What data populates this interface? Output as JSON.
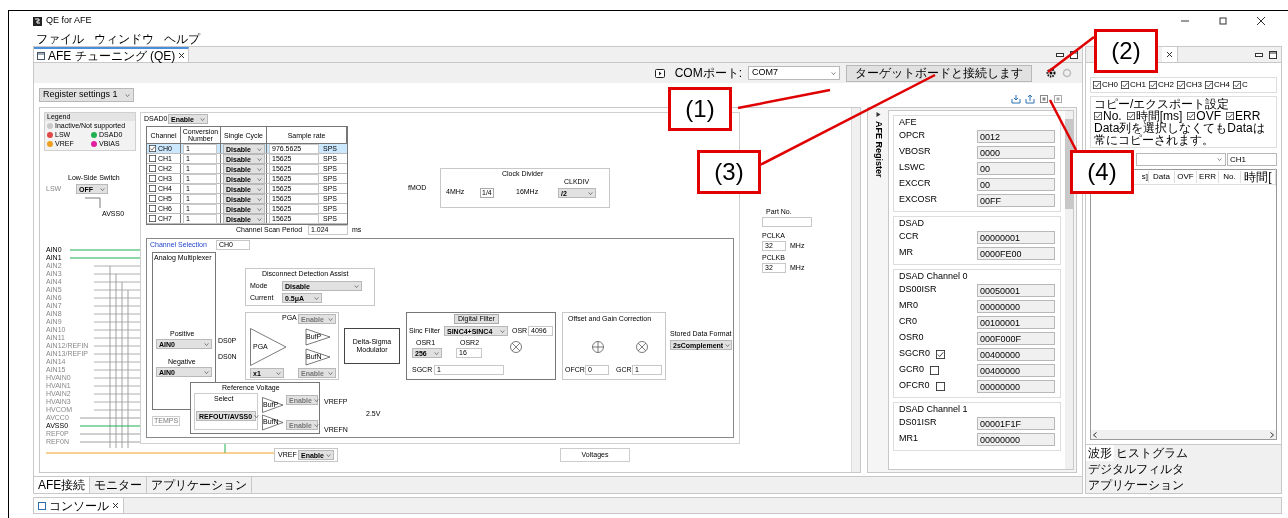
{
  "window": {
    "title": "QE for AFE"
  },
  "menu": [
    "ファイル",
    "ウィンドウ",
    "ヘルプ"
  ],
  "editor_tab": {
    "label": "AFE チューニング (QE)"
  },
  "toolbar": {
    "com_label": "COMポート:",
    "com_value": "COM7",
    "connect_button": "ターゲットボードと接続します"
  },
  "register_select": "Register settings 1",
  "legend": {
    "title": "Legend",
    "items": [
      {
        "label": "Inactive/Not supported",
        "color": "#c8c8c8"
      },
      {
        "label": "LSW",
        "color": "#e04848"
      },
      {
        "label": "DSAD0",
        "color": "#20b050"
      },
      {
        "label": "VREF",
        "color": "#f0a020"
      },
      {
        "label": "VBIAS",
        "color": "#e020a0"
      }
    ]
  },
  "dsad0": {
    "label": "DSAD0",
    "value": "Enable"
  },
  "channel_table": {
    "columns": [
      "Channel",
      "Conversion Number",
      "Single Cycle",
      "Sample rate"
    ],
    "rows": [
      {
        "channel": "CH0",
        "checked": true,
        "selected": true,
        "number": "1",
        "cycle": "Disable",
        "rate": "976.5625",
        "unit": "SPS"
      },
      {
        "channel": "CH1",
        "checked": false,
        "selected": false,
        "number": "1",
        "cycle": "Disable",
        "rate": "15625",
        "unit": "SPS"
      },
      {
        "channel": "CH2",
        "checked": false,
        "selected": false,
        "number": "1",
        "cycle": "Disable",
        "rate": "15625",
        "unit": "SPS"
      },
      {
        "channel": "CH3",
        "checked": false,
        "selected": false,
        "number": "1",
        "cycle": "Disable",
        "rate": "15625",
        "unit": "SPS"
      },
      {
        "channel": "CH4",
        "checked": false,
        "selected": false,
        "number": "1",
        "cycle": "Disable",
        "rate": "15625",
        "unit": "SPS"
      },
      {
        "channel": "CH5",
        "checked": false,
        "selected": false,
        "number": "1",
        "cycle": "Disable",
        "rate": "15625",
        "unit": "SPS"
      },
      {
        "channel": "CH6",
        "checked": false,
        "selected": false,
        "number": "1",
        "cycle": "Disable",
        "rate": "15625",
        "unit": "SPS"
      },
      {
        "channel": "CH7",
        "checked": false,
        "selected": false,
        "number": "1",
        "cycle": "Disable",
        "rate": "15625",
        "unit": "SPS"
      }
    ],
    "scan_label": "Channel Scan Period",
    "scan_value": "1.024",
    "scan_unit": "ms"
  },
  "low_side_switch": {
    "title": "Low-Side Switch",
    "value": "OFF",
    "pin": "LSW",
    "ground": "AVSS0"
  },
  "clock_divider": {
    "title": "Clock Divider",
    "fmod": "fMOD",
    "out": "4MHz",
    "ratio": "1/4",
    "in": "16MHz",
    "clkdiv_label": "CLKDIV",
    "clkdiv_value": "/2"
  },
  "part": {
    "label": "Part No.",
    "clocks": [
      {
        "label": "PCLKA",
        "value": "32",
        "unit": "MHz"
      },
      {
        "label": "PCLKB",
        "value": "32",
        "unit": "MHz"
      }
    ]
  },
  "channel_selection": {
    "label": "Channel Selection",
    "value": "CH0"
  },
  "pins": [
    "AIN0",
    "AIN1",
    "AIN2",
    "AIN3",
    "AIN4",
    "AIN5",
    "AIN6",
    "AIN7",
    "AIN8",
    "AIN9",
    "AIN10",
    "AIN11",
    "AIN12/REFIN",
    "AIN13/REFIP",
    "AIN14",
    "AIN15",
    "HVAIN0",
    "HVAIN1",
    "HVAIN2",
    "HVAIN3",
    "HVCOM"
  ],
  "power_pins": [
    "AVCC0",
    "AVSS0",
    "REF0P",
    "REF0N"
  ],
  "mux": {
    "title": "Analog Multiplexer",
    "positive_label": "Positive",
    "positive": "AIN0",
    "negative_label": "Negative",
    "negative": "AIN0",
    "outp": "DS0P",
    "outn": "DS0N",
    "temps": "TEMPS"
  },
  "disconnect": {
    "title": "Disconnect Detection Assist",
    "mode_label": "Mode",
    "mode": "Disable",
    "current_label": "Current",
    "current": "0.5μA"
  },
  "pga": {
    "title": "PGA",
    "amp": "PGA",
    "bufp": "BufP",
    "bufn": "BufN",
    "enable_top": "Enable",
    "enable_bottom": "Enable",
    "gain": "x1"
  },
  "modulator": {
    "label": "Delta-Sigma Modulator"
  },
  "digital_filter": {
    "button": "Digital Filter",
    "sinc_label": "Sinc Filter",
    "sinc": "SINC4+SINC4",
    "osr_label": "OSR",
    "osr": "4096",
    "osr1_label": "OSR1",
    "osr1": "256",
    "osr2_label": "OSR2",
    "osr2": "16",
    "sgcr_label": "SGCR",
    "sgcr": "1"
  },
  "offset_gain": {
    "title": "Offset and Gain Correction",
    "ofcr_label": "OFCR",
    "ofcr": "0",
    "gcr_label": "GCR",
    "gcr": "1"
  },
  "stored_format": {
    "label": "Stored Data Format",
    "value": "2sComplement"
  },
  "reference": {
    "title": "Reference Voltage",
    "select_label": "Select",
    "select": "REFOUT/AVSS0",
    "enable_top": "Enable",
    "enable_bottom": "Enable",
    "bufp": "BufP",
    "bufn": "BufN",
    "vrefp": "VREFP",
    "vrefn": "VREFN",
    "voltage": "2.5V"
  },
  "vref": {
    "label": "VREF",
    "value": "Enable"
  },
  "voltages": {
    "label": "Voltages"
  },
  "register_panel": {
    "title": "AFE Register",
    "sections": [
      {
        "title": "AFE",
        "rows": [
          {
            "kind": "plain",
            "name": "OPCR",
            "value": "0012"
          },
          {
            "kind": "plain",
            "name": "VBOSR",
            "value": "0000"
          },
          {
            "kind": "plain",
            "name": "LSWC",
            "value": "00"
          },
          {
            "kind": "plain",
            "name": "EXCCR",
            "value": "00"
          },
          {
            "kind": "plain",
            "name": "EXCOSR",
            "value": "00FF"
          }
        ]
      },
      {
        "title": "DSAD",
        "rows": [
          {
            "kind": "plain",
            "name": "CCR",
            "value": "00000001"
          },
          {
            "kind": "plain",
            "name": "MR",
            "value": "0000FE00"
          }
        ]
      },
      {
        "title": "DSAD Channel 0",
        "rows": [
          {
            "kind": "plain",
            "name": "DS00ISR",
            "value": "00050001"
          },
          {
            "kind": "plain",
            "name": "MR0",
            "value": "00000000"
          },
          {
            "kind": "plain",
            "name": "CR0",
            "value": "00100001"
          },
          {
            "kind": "plain",
            "name": "OSR0",
            "value": "000F000F"
          },
          {
            "kind": "check",
            "name": "SGCR0",
            "checked": true,
            "value": "00400000"
          },
          {
            "kind": "check",
            "name": "GCR0",
            "checked": false,
            "value": "00400000"
          },
          {
            "kind": "check",
            "name": "OFCR0",
            "checked": false,
            "value": "00000000"
          }
        ]
      },
      {
        "title": "DSAD Channel 1",
        "rows": [
          {
            "kind": "plain",
            "name": "DS01ISR",
            "value": "00001F1F"
          },
          {
            "kind": "plain",
            "name": "MR1",
            "value": "00000000"
          }
        ]
      }
    ]
  },
  "bottom_tabs": [
    {
      "label": "AFE接続",
      "selected": true
    },
    {
      "label": "モニター",
      "selected": false
    },
    {
      "label": "アプリケーション",
      "selected": false
    }
  ],
  "right_pane": {
    "channels": [
      {
        "label": "CH0",
        "checked": true
      },
      {
        "label": "CH1",
        "checked": true
      },
      {
        "label": "CH2",
        "checked": true
      },
      {
        "label": "CH3",
        "checked": true
      },
      {
        "label": "CH4",
        "checked": true
      },
      {
        "label": "C",
        "checked": true
      }
    ],
    "copy_title": "コピー/エクスポート設定",
    "copy_options": [
      {
        "label": "No.",
        "checked": true
      },
      {
        "label": "時間[ms]",
        "checked": true
      },
      {
        "label": "OVF",
        "checked": true
      },
      {
        "label": "ERR",
        "checked": true
      }
    ],
    "note": "Data列を選択しなくてもDataは常にコピーされます。",
    "channel_select": "CH1",
    "columns": [
      "s]",
      "Data",
      "OVF",
      "ERR",
      "No.",
      "時間["
    ],
    "tabs": [
      {
        "label": "波形",
        "selected": true
      },
      {
        "label": "ヒストグラム",
        "selected": false
      },
      {
        "label": "デジタルフィルタ",
        "selected": false
      },
      {
        "label": "アプリケーション",
        "selected": false
      }
    ]
  },
  "console_tab": {
    "label": "コンソール"
  },
  "callouts": [
    "(1)",
    "(2)",
    "(3)",
    "(4)"
  ]
}
